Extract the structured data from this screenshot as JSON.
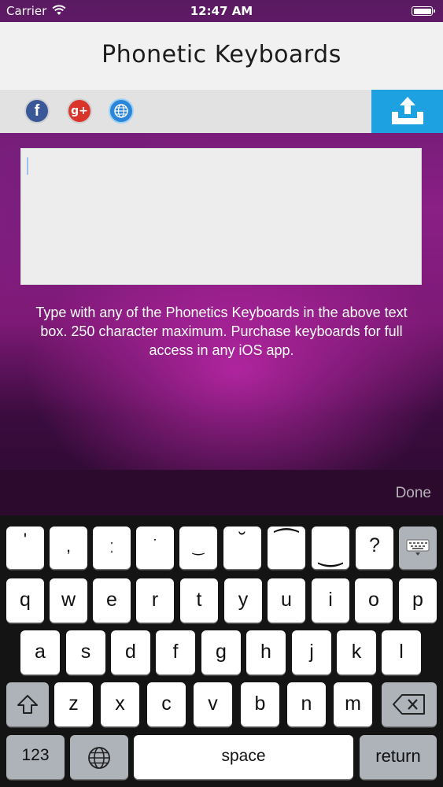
{
  "status_bar": {
    "carrier": "Carrier",
    "time": "12:47 AM"
  },
  "header": {
    "title": "Phonetic Keyboards"
  },
  "social": {
    "facebook_glyph": "f",
    "google_plus_glyph": "g+",
    "icons": [
      "facebook-icon",
      "google-plus-icon",
      "globe-icon",
      "upload-icon"
    ]
  },
  "editor": {
    "value": ""
  },
  "info": {
    "text": "Type with any of the Phonetics Keyboards in the above text box. 250 character maximum. Purchase keyboards for full access in any iOS app."
  },
  "keyboard_toolbar": {
    "done_label": "Done"
  },
  "keyboard": {
    "row1": [
      "'",
      ",",
      "ː",
      "ˑ",
      "‿",
      "˘",
      "⁀",
      "‿",
      "?"
    ],
    "row2": [
      "q",
      "w",
      "e",
      "r",
      "t",
      "y",
      "u",
      "i",
      "o",
      "p"
    ],
    "row3": [
      "a",
      "s",
      "d",
      "f",
      "g",
      "h",
      "j",
      "k",
      "l"
    ],
    "row4": [
      "z",
      "x",
      "c",
      "v",
      "b",
      "n",
      "m"
    ],
    "numbers_label": "123",
    "space_label": "space",
    "return_label": "return"
  },
  "colors": {
    "accent": "#1da1e0",
    "facebook": "#3a5797",
    "google_plus": "#d9352b",
    "background_purple": "#8a1f86"
  }
}
